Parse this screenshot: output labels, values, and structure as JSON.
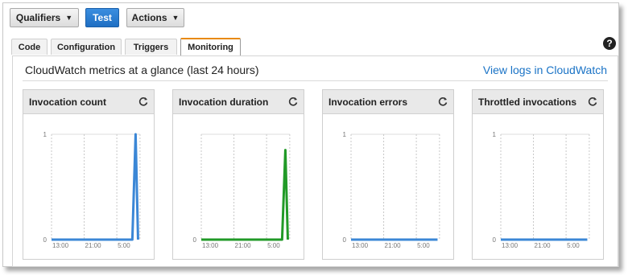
{
  "toolbar": {
    "qualifiers": "Qualifiers",
    "test": "Test",
    "actions": "Actions"
  },
  "tabs": [
    "Code",
    "Configuration",
    "Triggers",
    "Monitoring"
  ],
  "help_icon": "?",
  "panel": {
    "title": "CloudWatch metrics at a glance (last 24 hours)",
    "link": "View logs in CloudWatch"
  },
  "colors": {
    "blue": "#3b87d6",
    "green": "#219a27",
    "accent_tab": "#e8890c"
  },
  "widgets": [
    {
      "title": "Invocation count"
    },
    {
      "title": "Invocation duration"
    },
    {
      "title": "Invocation errors"
    },
    {
      "title": "Throttled invocations"
    }
  ],
  "chart_data": [
    {
      "type": "line",
      "title": "Invocation count",
      "ylim": [
        0,
        1
      ],
      "yticks": [
        "1",
        "0"
      ],
      "xticks": [
        "13:00",
        "21:00",
        "5:00"
      ],
      "x_hours": [
        0,
        19.8,
        20.6,
        21.2
      ],
      "series": [
        {
          "color": "#3b87d6",
          "values": [
            0,
            0,
            1,
            0
          ]
        }
      ]
    },
    {
      "type": "line",
      "title": "Invocation duration",
      "ylim": [
        0,
        1
      ],
      "yticks": [
        "0"
      ],
      "xticks": [
        "13:00",
        "21:00",
        "5:00"
      ],
      "x_hours": [
        0,
        19.8,
        20.6,
        21.2
      ],
      "series": [
        {
          "color": "#219a27",
          "values": [
            0,
            0,
            0.85,
            0
          ]
        }
      ]
    },
    {
      "type": "line",
      "title": "Invocation errors",
      "ylim": [
        0,
        1
      ],
      "yticks": [
        "1",
        "0"
      ],
      "xticks": [
        "13:00",
        "21:00",
        "5:00"
      ],
      "x_hours": [
        0,
        21.2
      ],
      "series": [
        {
          "color": "#3b87d6",
          "values": [
            0,
            0
          ]
        }
      ]
    },
    {
      "type": "line",
      "title": "Throttled invocations",
      "ylim": [
        0,
        1
      ],
      "yticks": [
        "1",
        "0"
      ],
      "xticks": [
        "13:00",
        "21:00",
        "5:00"
      ],
      "x_hours": [
        0,
        21.2
      ],
      "series": [
        {
          "color": "#3b87d6",
          "values": [
            0,
            0
          ]
        }
      ]
    }
  ]
}
